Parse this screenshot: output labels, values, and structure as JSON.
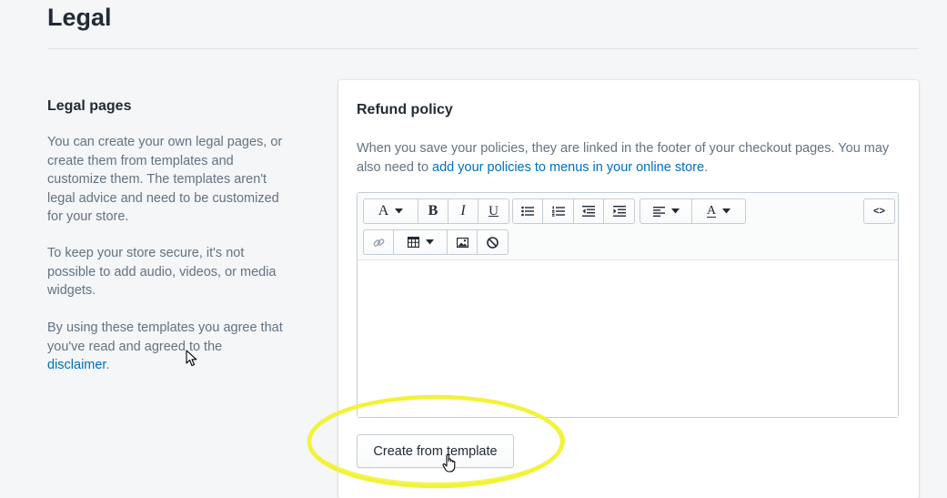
{
  "page": {
    "title": "Legal"
  },
  "annotation": {
    "heading": "Legal pages",
    "paragraph1": "You can create your own legal pages, or create them from templates and customize them. The templates aren't legal advice and need to be customized for your store.",
    "paragraph2": "To keep your store secure, it's not possible to add audio, videos, or media widgets.",
    "paragraph3_prefix": "By using these templates you agree that you've read and agreed to the",
    "paragraph3_link": "disclaimer",
    "paragraph3_suffix": "."
  },
  "card": {
    "title": "Refund policy",
    "help_prefix": "When you save your policies, they are linked in the footer of your checkout pages. You may also need to",
    "help_link": "add your policies to menus in your online store",
    "help_suffix": ".",
    "editor_content": "",
    "create_button_label": "Create from template"
  },
  "toolbar": {
    "row1": [
      {
        "name": "font-style-dropdown",
        "glyph": "A",
        "dropdown": true
      },
      {
        "name": "bold-button",
        "glyph": "B"
      },
      {
        "name": "italic-button",
        "glyph": "I"
      },
      {
        "name": "underline-button",
        "glyph": "U"
      },
      {
        "name": "bullet-list-button",
        "icon": "bullet-list-icon"
      },
      {
        "name": "numbered-list-button",
        "icon": "numbered-list-icon"
      },
      {
        "name": "outdent-button",
        "icon": "outdent-icon"
      },
      {
        "name": "indent-button",
        "icon": "indent-icon"
      },
      {
        "name": "align-dropdown",
        "icon": "align-left-icon",
        "dropdown": true
      },
      {
        "name": "text-color-dropdown",
        "glyph": "A",
        "dropdown": true
      },
      {
        "name": "html-toggle-button",
        "glyph": "<>"
      }
    ],
    "row2": [
      {
        "name": "link-button",
        "icon": "link-icon"
      },
      {
        "name": "table-dropdown",
        "icon": "table-icon",
        "dropdown": true
      },
      {
        "name": "image-button",
        "icon": "image-icon"
      },
      {
        "name": "clear-formatting-button",
        "icon": "block-icon"
      }
    ]
  },
  "overlay": {
    "highlight_color": "#f2f23a"
  }
}
